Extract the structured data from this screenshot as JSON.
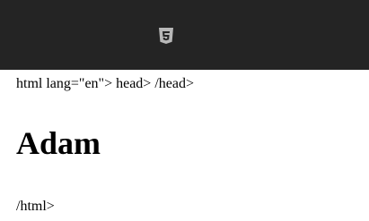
{
  "header": {
    "icon": "html5-icon",
    "background_color": "#242424",
    "icon_color": "#b8b8b8"
  },
  "content": {
    "line_top": "html lang=\"en\"> head> /head>",
    "heading": "Adam",
    "line_bottom": "/html>"
  }
}
